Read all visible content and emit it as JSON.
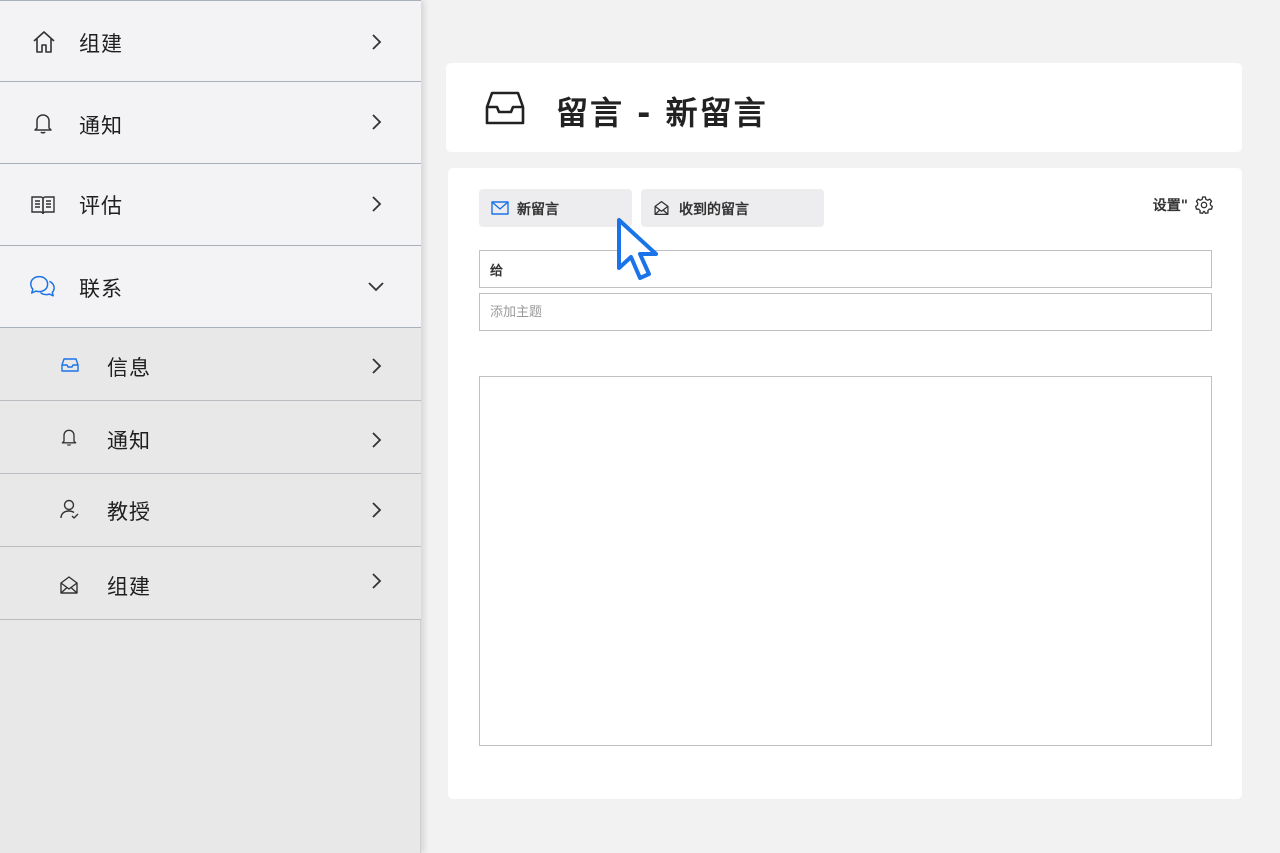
{
  "sidebar": {
    "items": [
      {
        "label": "组建",
        "icon": "home-icon",
        "expanded": false
      },
      {
        "label": "通知",
        "icon": "bell-icon",
        "expanded": false
      },
      {
        "label": "评估",
        "icon": "book-icon",
        "expanded": false
      },
      {
        "label": "联系",
        "icon": "chat-bubbles-icon",
        "expanded": true
      }
    ],
    "subitems": [
      {
        "label": "信息",
        "icon": "inbox-icon"
      },
      {
        "label": "通知",
        "icon": "bell-icon"
      },
      {
        "label": "教授",
        "icon": "person-icon"
      },
      {
        "label": "组建",
        "icon": "open-envelope-icon"
      }
    ]
  },
  "header": {
    "title": "留言 - 新留言",
    "icon": "inbox-tray-icon"
  },
  "tabs": [
    {
      "label": "新留言",
      "icon": "envelope-icon",
      "active": true
    },
    {
      "label": "收到的留言",
      "icon": "open-envelope-icon",
      "active": false
    }
  ],
  "settings": {
    "label": "设置\"",
    "icon": "gear-icon"
  },
  "form": {
    "to_value": "给",
    "subject_placeholder": "添加主题",
    "body_value": ""
  },
  "colors": {
    "accent": "#1a73e8",
    "sidebar_bg": "#e8e8e9",
    "top_item_bg": "#f3f3f5",
    "page_bg": "#f2f2f3"
  }
}
